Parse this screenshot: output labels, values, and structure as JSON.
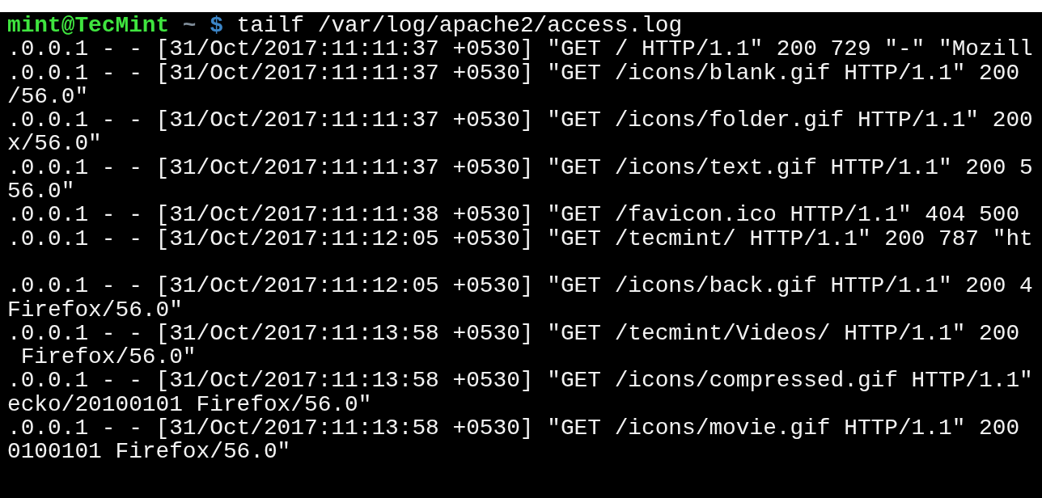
{
  "prompt": {
    "user_host": "mint@TecMint",
    "path": "~",
    "symbol": "$",
    "command": "tailf /var/log/apache2/access.log"
  },
  "lines": [
    {
      "kind": "text",
      "text": ".0.0.1 - - [31/Oct/2017:11:11:37 +0530] \"GET / HTTP/1.1\" 200 729 \"-\" \"Mozill"
    },
    {
      "kind": "text",
      "text": ".0.0.1 - - [31/Oct/2017:11:11:37 +0530] \"GET /icons/blank.gif HTTP/1.1\" 200"
    },
    {
      "kind": "text",
      "text": "/56.0\""
    },
    {
      "kind": "text",
      "text": ".0.0.1 - - [31/Oct/2017:11:11:37 +0530] \"GET /icons/folder.gif HTTP/1.1\" 200"
    },
    {
      "kind": "text",
      "text": "x/56.0\""
    },
    {
      "kind": "text",
      "text": ".0.0.1 - - [31/Oct/2017:11:11:37 +0530] \"GET /icons/text.gif HTTP/1.1\" 200 5"
    },
    {
      "kind": "text",
      "text": "56.0\""
    },
    {
      "kind": "text",
      "text": ".0.0.1 - - [31/Oct/2017:11:11:38 +0530] \"GET /favicon.ico HTTP/1.1\" 404 500"
    },
    {
      "kind": "text",
      "text": ".0.0.1 - - [31/Oct/2017:11:12:05 +0530] \"GET /tecmint/ HTTP/1.1\" 200 787 \"ht"
    },
    {
      "kind": "blank"
    },
    {
      "kind": "text",
      "text": ".0.0.1 - - [31/Oct/2017:11:12:05 +0530] \"GET /icons/back.gif HTTP/1.1\" 200 4"
    },
    {
      "kind": "text",
      "text": "Firefox/56.0\""
    },
    {
      "kind": "text",
      "text": ".0.0.1 - - [31/Oct/2017:11:13:58 +0530] \"GET /tecmint/Videos/ HTTP/1.1\" 200"
    },
    {
      "kind": "text",
      "text": " Firefox/56.0\""
    },
    {
      "kind": "text",
      "text": ".0.0.1 - - [31/Oct/2017:11:13:58 +0530] \"GET /icons/compressed.gif HTTP/1.1\""
    },
    {
      "kind": "text",
      "text": "ecko/20100101 Firefox/56.0\""
    },
    {
      "kind": "text",
      "text": ".0.0.1 - - [31/Oct/2017:11:13:58 +0530] \"GET /icons/movie.gif HTTP/1.1\" 200"
    },
    {
      "kind": "text",
      "text": "0100101 Firefox/56.0\""
    }
  ]
}
